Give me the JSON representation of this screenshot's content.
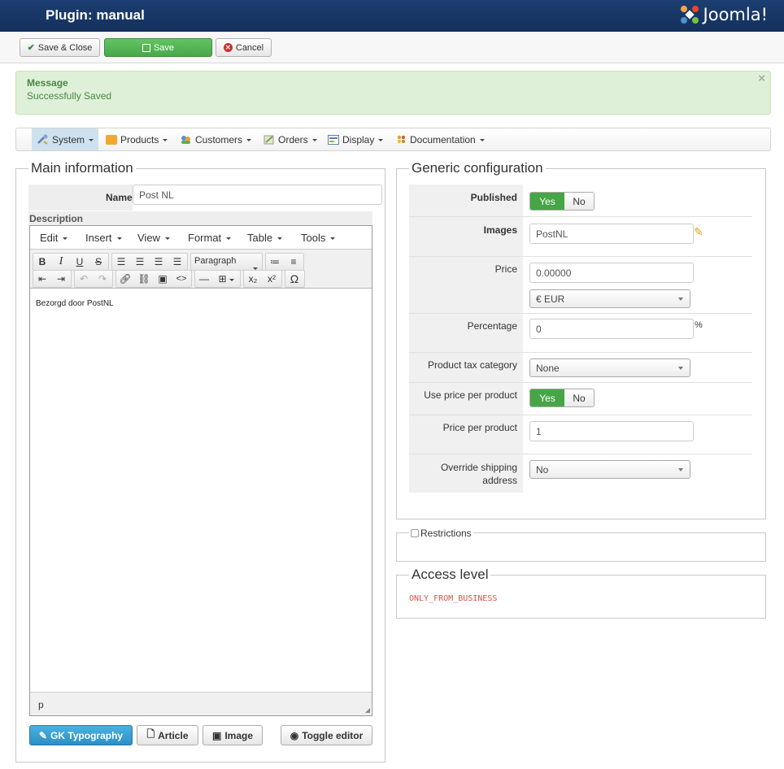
{
  "header": {
    "title": "Plugin: manual",
    "logo_text": "Joomla!"
  },
  "toolbar": {
    "save_close": "Save & Close",
    "save": "Save",
    "cancel": "Cancel"
  },
  "message": {
    "heading": "Message",
    "text": "Successfully Saved",
    "close": "×"
  },
  "menu": {
    "items": [
      "System",
      "Products",
      "Customers",
      "Orders",
      "Display",
      "Documentation"
    ],
    "active": "System"
  },
  "main_info": {
    "legend": "Main information",
    "name_label": "Name",
    "name_value": "Post NL",
    "description_label": "Description",
    "editor": {
      "menus": [
        "Edit",
        "Insert",
        "View",
        "Format",
        "Table",
        "Tools"
      ],
      "block_format": "Paragraph",
      "content": "Bezorgd door PostNL",
      "status_path": "p"
    },
    "buttons": {
      "gk": "GK Typography",
      "article": "Article",
      "image": "Image",
      "toggle": "Toggle editor"
    }
  },
  "generic": {
    "legend": "Generic configuration",
    "published_label": "Published",
    "yes": "Yes",
    "no": "No",
    "images_label": "Images",
    "images_value": "PostNL",
    "price_label": "Price",
    "price_value": "0.00000",
    "currency": "€ EUR",
    "percentage_label": "Percentage",
    "percentage_value": "0",
    "percent_sign": "%",
    "tax_label": "Product tax category",
    "tax_value": "None",
    "use_ppp_label": "Use price per product",
    "ppp_label": "Price per product",
    "ppp_value": "1",
    "override_label_1": "Override shipping",
    "override_label_2": "address",
    "override_value": "No"
  },
  "restrictions": {
    "label": "Restrictions",
    "checked": false
  },
  "access": {
    "legend": "Access level",
    "value": "ONLY_FROM_BUSINESS",
    "value_color": "#d9534f"
  },
  "colors": {
    "header": "#1a3867",
    "success": "#46a546",
    "primary": "#2c8fc5",
    "message_bg": "#dff0d8"
  }
}
